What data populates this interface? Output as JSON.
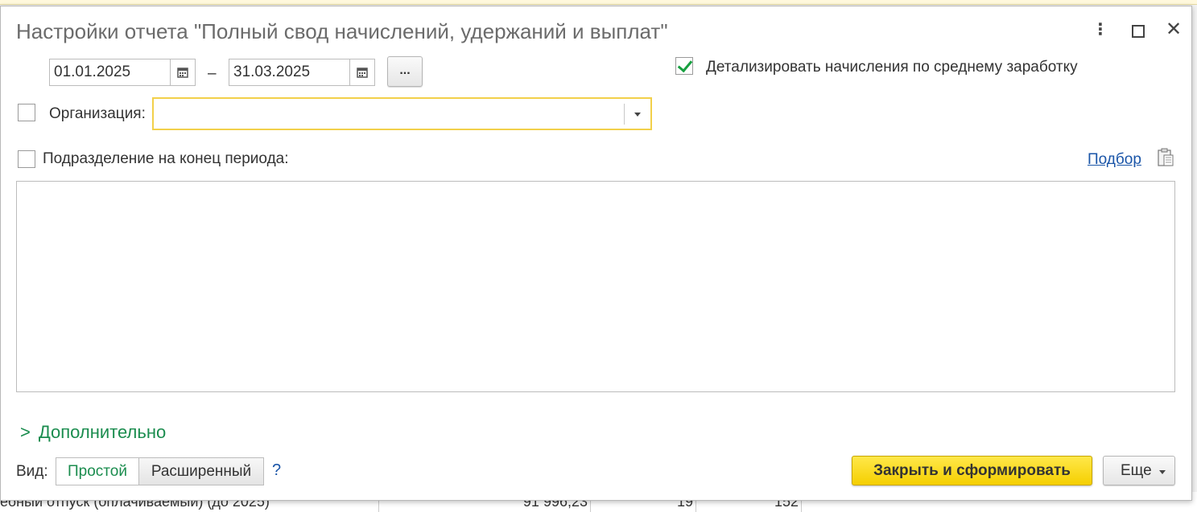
{
  "dialog": {
    "title": "Настройки отчета \"Полный свод начислений, удержаний и выплат\"",
    "menu_icon": "more-vertical-icon",
    "maximize_icon": "maximize-icon",
    "close_icon": "close-icon"
  },
  "period": {
    "start_date": "01.01.2025",
    "end_date": "31.03.2025",
    "separator": "–",
    "more_button_label": "..."
  },
  "detail_average": {
    "checked": true,
    "label": "Детализировать начисления по среднему заработку"
  },
  "organization": {
    "checked": false,
    "label": "Организация:",
    "value": ""
  },
  "subdivision": {
    "checked": false,
    "label": "Подразделение на конец периода:",
    "select_link": "Подбор",
    "clipboard_icon": "clipboard-icon"
  },
  "additional_section": {
    "label": "Дополнительно",
    "expanded": false
  },
  "view": {
    "label": "Вид:",
    "options": [
      "Простой",
      "Расширенный"
    ],
    "selected": "Простой",
    "help": "?"
  },
  "buttons": {
    "primary": "Закрыть и сформировать",
    "more": "Еще"
  },
  "background_row": {
    "text": "ебный отпуск (оплачиваемый) (до 2025)",
    "amount": "91 996,23",
    "col2": "19",
    "col3": "152"
  },
  "colors": {
    "accent_green": "#1a8c4e",
    "link_blue": "#1a55a8",
    "primary_yellow": "#f5cf00",
    "focus_border": "#f2d04a"
  }
}
